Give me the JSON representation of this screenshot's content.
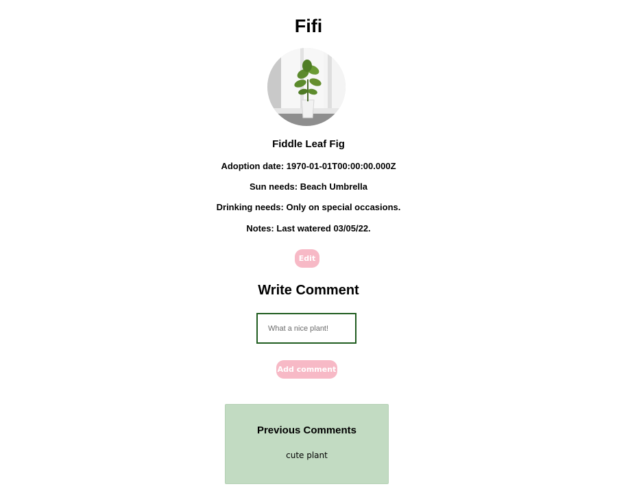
{
  "plant": {
    "name": "Fifi",
    "species": "Fiddle Leaf Fig",
    "adoption_date": "Adoption date: 1970-01-01T00:00:00.000Z",
    "sun_needs": "Sun needs: Beach Umbrella",
    "drinking_needs": "Drinking needs: Only on special occasions.",
    "notes": "Notes: Last watered 03/05/22.",
    "photo_icon": "potted-plant-photo"
  },
  "actions": {
    "edit_label": "Edit",
    "add_comment_label": "Add comment"
  },
  "write_comment": {
    "heading": "Write Comment",
    "placeholder": "What a nice plant!",
    "value": ""
  },
  "previous_comments": {
    "heading": "Previous Comments",
    "items": [
      "cute plant"
    ]
  },
  "colors": {
    "button_pink": "#f7b9c6",
    "comments_panel_green": "#c2dbc2",
    "input_border_green": "#1f5c1f"
  }
}
